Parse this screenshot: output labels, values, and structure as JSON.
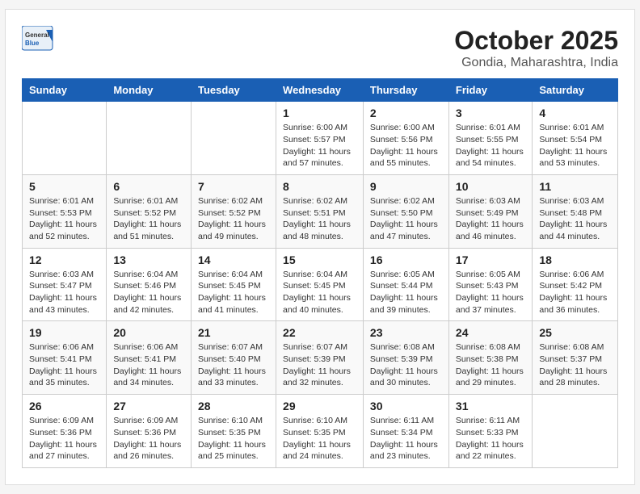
{
  "header": {
    "logo_general": "General",
    "logo_blue": "Blue",
    "month": "October 2025",
    "location": "Gondia, Maharashtra, India"
  },
  "weekdays": [
    "Sunday",
    "Monday",
    "Tuesday",
    "Wednesday",
    "Thursday",
    "Friday",
    "Saturday"
  ],
  "weeks": [
    [
      {
        "day": "",
        "info": ""
      },
      {
        "day": "",
        "info": ""
      },
      {
        "day": "",
        "info": ""
      },
      {
        "day": "1",
        "info": "Sunrise: 6:00 AM\nSunset: 5:57 PM\nDaylight: 11 hours and 57 minutes."
      },
      {
        "day": "2",
        "info": "Sunrise: 6:00 AM\nSunset: 5:56 PM\nDaylight: 11 hours and 55 minutes."
      },
      {
        "day": "3",
        "info": "Sunrise: 6:01 AM\nSunset: 5:55 PM\nDaylight: 11 hours and 54 minutes."
      },
      {
        "day": "4",
        "info": "Sunrise: 6:01 AM\nSunset: 5:54 PM\nDaylight: 11 hours and 53 minutes."
      }
    ],
    [
      {
        "day": "5",
        "info": "Sunrise: 6:01 AM\nSunset: 5:53 PM\nDaylight: 11 hours and 52 minutes."
      },
      {
        "day": "6",
        "info": "Sunrise: 6:01 AM\nSunset: 5:52 PM\nDaylight: 11 hours and 51 minutes."
      },
      {
        "day": "7",
        "info": "Sunrise: 6:02 AM\nSunset: 5:52 PM\nDaylight: 11 hours and 49 minutes."
      },
      {
        "day": "8",
        "info": "Sunrise: 6:02 AM\nSunset: 5:51 PM\nDaylight: 11 hours and 48 minutes."
      },
      {
        "day": "9",
        "info": "Sunrise: 6:02 AM\nSunset: 5:50 PM\nDaylight: 11 hours and 47 minutes."
      },
      {
        "day": "10",
        "info": "Sunrise: 6:03 AM\nSunset: 5:49 PM\nDaylight: 11 hours and 46 minutes."
      },
      {
        "day": "11",
        "info": "Sunrise: 6:03 AM\nSunset: 5:48 PM\nDaylight: 11 hours and 44 minutes."
      }
    ],
    [
      {
        "day": "12",
        "info": "Sunrise: 6:03 AM\nSunset: 5:47 PM\nDaylight: 11 hours and 43 minutes."
      },
      {
        "day": "13",
        "info": "Sunrise: 6:04 AM\nSunset: 5:46 PM\nDaylight: 11 hours and 42 minutes."
      },
      {
        "day": "14",
        "info": "Sunrise: 6:04 AM\nSunset: 5:45 PM\nDaylight: 11 hours and 41 minutes."
      },
      {
        "day": "15",
        "info": "Sunrise: 6:04 AM\nSunset: 5:45 PM\nDaylight: 11 hours and 40 minutes."
      },
      {
        "day": "16",
        "info": "Sunrise: 6:05 AM\nSunset: 5:44 PM\nDaylight: 11 hours and 39 minutes."
      },
      {
        "day": "17",
        "info": "Sunrise: 6:05 AM\nSunset: 5:43 PM\nDaylight: 11 hours and 37 minutes."
      },
      {
        "day": "18",
        "info": "Sunrise: 6:06 AM\nSunset: 5:42 PM\nDaylight: 11 hours and 36 minutes."
      }
    ],
    [
      {
        "day": "19",
        "info": "Sunrise: 6:06 AM\nSunset: 5:41 PM\nDaylight: 11 hours and 35 minutes."
      },
      {
        "day": "20",
        "info": "Sunrise: 6:06 AM\nSunset: 5:41 PM\nDaylight: 11 hours and 34 minutes."
      },
      {
        "day": "21",
        "info": "Sunrise: 6:07 AM\nSunset: 5:40 PM\nDaylight: 11 hours and 33 minutes."
      },
      {
        "day": "22",
        "info": "Sunrise: 6:07 AM\nSunset: 5:39 PM\nDaylight: 11 hours and 32 minutes."
      },
      {
        "day": "23",
        "info": "Sunrise: 6:08 AM\nSunset: 5:39 PM\nDaylight: 11 hours and 30 minutes."
      },
      {
        "day": "24",
        "info": "Sunrise: 6:08 AM\nSunset: 5:38 PM\nDaylight: 11 hours and 29 minutes."
      },
      {
        "day": "25",
        "info": "Sunrise: 6:08 AM\nSunset: 5:37 PM\nDaylight: 11 hours and 28 minutes."
      }
    ],
    [
      {
        "day": "26",
        "info": "Sunrise: 6:09 AM\nSunset: 5:36 PM\nDaylight: 11 hours and 27 minutes."
      },
      {
        "day": "27",
        "info": "Sunrise: 6:09 AM\nSunset: 5:36 PM\nDaylight: 11 hours and 26 minutes."
      },
      {
        "day": "28",
        "info": "Sunrise: 6:10 AM\nSunset: 5:35 PM\nDaylight: 11 hours and 25 minutes."
      },
      {
        "day": "29",
        "info": "Sunrise: 6:10 AM\nSunset: 5:35 PM\nDaylight: 11 hours and 24 minutes."
      },
      {
        "day": "30",
        "info": "Sunrise: 6:11 AM\nSunset: 5:34 PM\nDaylight: 11 hours and 23 minutes."
      },
      {
        "day": "31",
        "info": "Sunrise: 6:11 AM\nSunset: 5:33 PM\nDaylight: 11 hours and 22 minutes."
      },
      {
        "day": "",
        "info": ""
      }
    ]
  ]
}
